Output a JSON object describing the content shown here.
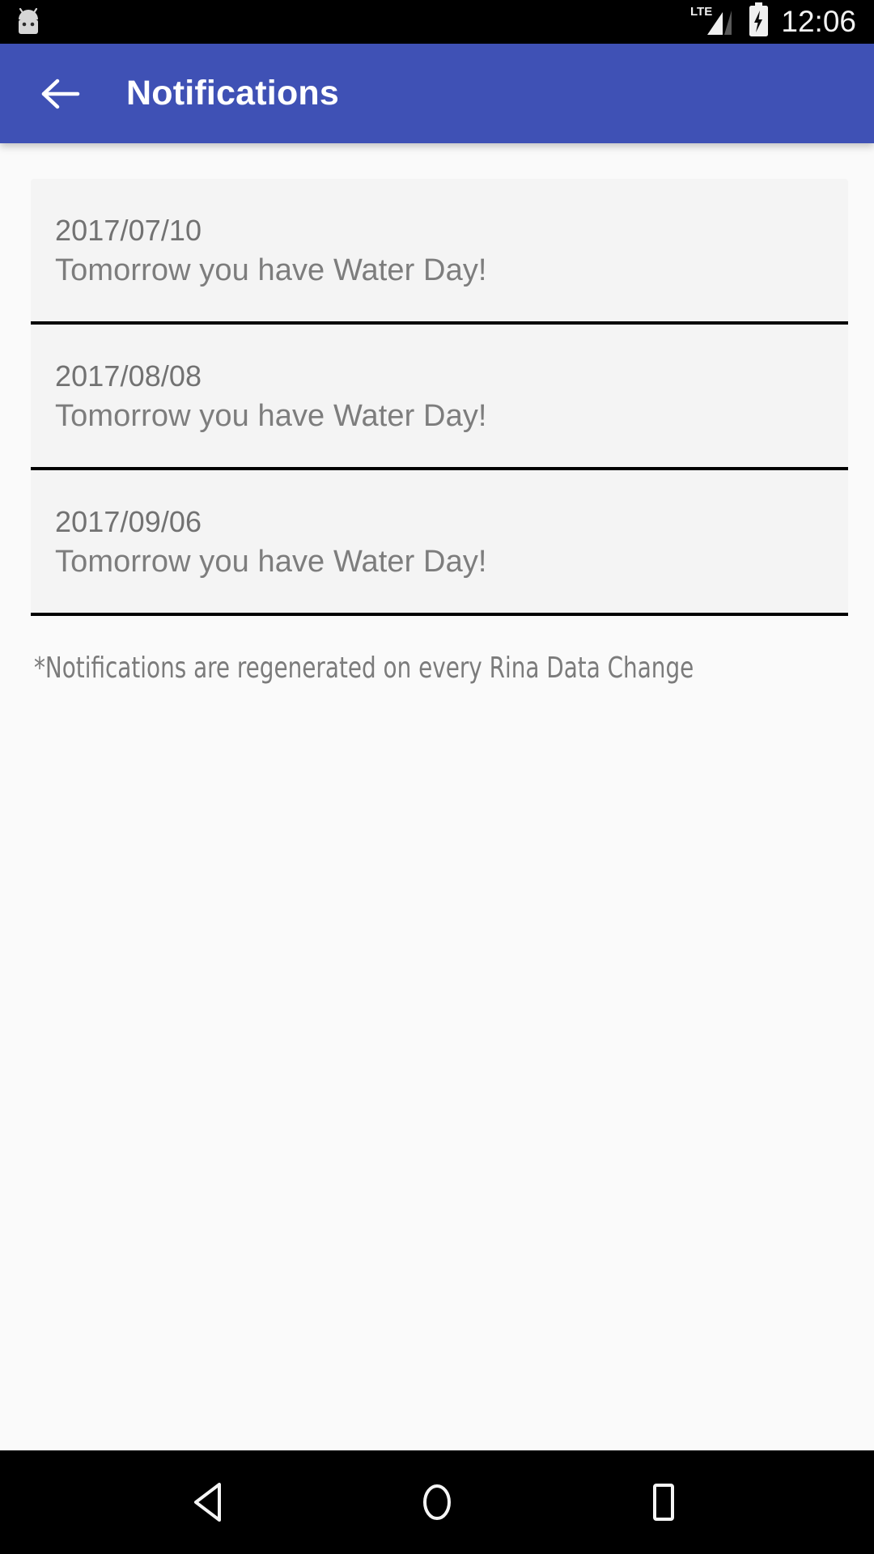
{
  "status_bar": {
    "notification_icon": "android-robot-icon",
    "network_label": "LTE",
    "signal_icon": "signal-bars-icon",
    "battery_icon": "battery-charging-icon",
    "time": "12:06"
  },
  "app_bar": {
    "back_icon": "back-arrow-icon",
    "title": "Notifications"
  },
  "notifications": [
    {
      "date": "2017/07/10",
      "message": "Tomorrow you have Water Day!"
    },
    {
      "date": "2017/08/08",
      "message": "Tomorrow you have Water Day!"
    },
    {
      "date": "2017/09/06",
      "message": "Tomorrow you have Water Day!"
    }
  ],
  "footnote": "*Notifications are regenerated on every Rina Data Change",
  "nav_bar": {
    "back_label": "Back",
    "home_label": "Home",
    "recents_label": "Recents"
  },
  "colors": {
    "app_bar": "#3f51b5",
    "page_background": "#fafafa",
    "card_background": "#f4f4f4",
    "divider": "#000000",
    "text_secondary": "#7d7d7d",
    "status_bar": "#000000"
  }
}
